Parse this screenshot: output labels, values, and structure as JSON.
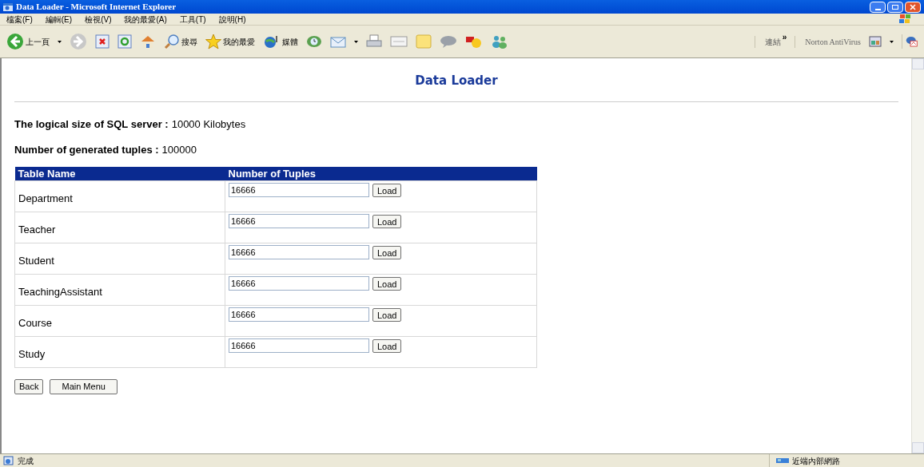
{
  "window": {
    "title": "Data Loader - Microsoft Internet Explorer"
  },
  "menu": [
    "檔案(F)",
    "編輯(E)",
    "檢視(V)",
    "我的最愛(A)",
    "工具(T)",
    "說明(H)"
  ],
  "toolbar": {
    "back": "上一頁",
    "search": "搜尋",
    "favorites": "我的最愛",
    "media": "媒體",
    "links": "連結",
    "chevron": "»",
    "norton": "Norton AntiVirus"
  },
  "page": {
    "heading": "Data Loader",
    "info": [
      {
        "label": "The logical size of SQL server :",
        "value": "10000 Kilobytes"
      },
      {
        "label": "Number of generated tuples :",
        "value": "100000"
      }
    ],
    "table": {
      "columns": [
        "Table Name",
        "Number of Tuples"
      ],
      "rows": [
        {
          "name": "Department",
          "value": "16666",
          "button": "Load"
        },
        {
          "name": "Teacher",
          "value": "16666",
          "button": "Load"
        },
        {
          "name": "Student",
          "value": "16666",
          "button": "Load"
        },
        {
          "name": "TeachingAssistant",
          "value": "16666",
          "button": "Load"
        },
        {
          "name": "Course",
          "value": "16666",
          "button": "Load"
        },
        {
          "name": "Study",
          "value": "16666",
          "button": "Load"
        }
      ]
    },
    "buttons": [
      "Back",
      "Main Menu"
    ]
  },
  "status_bar": {
    "text": "完成",
    "zone": "近端內部網路"
  }
}
